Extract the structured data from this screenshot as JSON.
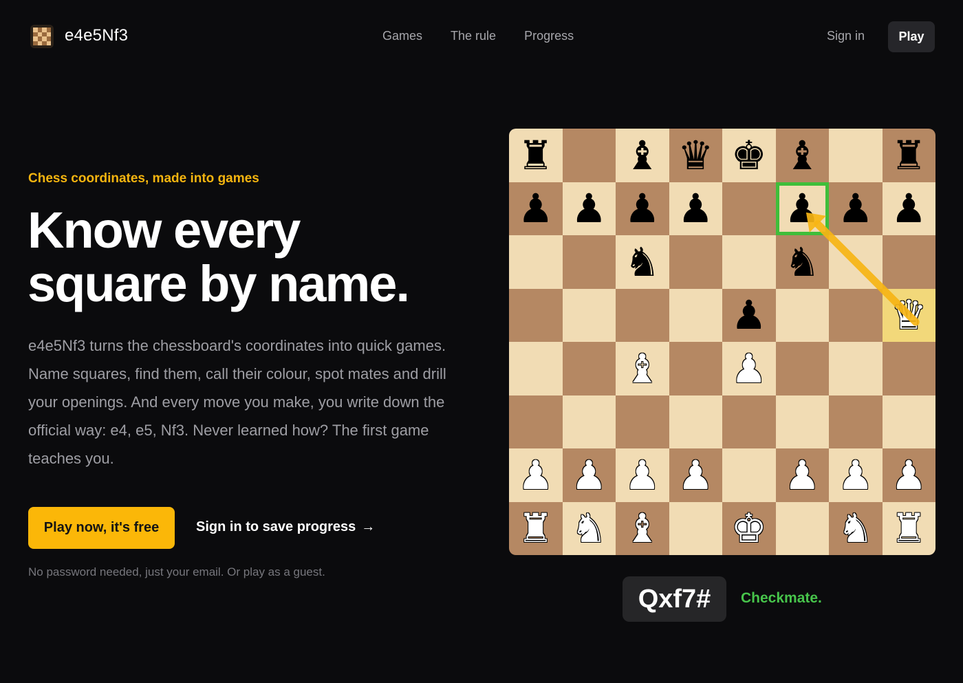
{
  "nav": {
    "brand": "e4e5Nf3",
    "logo_icon": "chessboard-logo-icon",
    "links": [
      {
        "label": "Games"
      },
      {
        "label": "The rule"
      },
      {
        "label": "Progress"
      }
    ],
    "signin_label": "Sign in",
    "play_label": "Play"
  },
  "hero": {
    "eyebrow": "Chess coordinates, made into games",
    "headline_line1": "Know every",
    "headline_line2": "square by name.",
    "lead": "e4e5Nf3 turns the chessboard's coordinates into quick games. Name squares, find them, call their colour, spot mates and drill your openings. And every move you make, you write down the official way: e4, e5, Nf3. Never learned how? The first game teaches you.",
    "cta_primary": "Play now, it's free",
    "cta_secondary": "Sign in to save progress",
    "cta_secondary_icon": "arrow-right-icon",
    "note": "No password needed, just your email. Or play as a guest."
  },
  "board": {
    "ranks": [
      "r.bqkb.r",
      "pppp.ppp",
      "..n..n..",
      "....p..Q",
      "..B.P...",
      "........",
      "PPPP.PPP",
      "RNB.K.NR"
    ],
    "highlight_target": "h5",
    "highlight_check": "f7",
    "arrow": {
      "from": "h5",
      "to": "f7"
    },
    "colors": {
      "light": "#f1dcb4",
      "dark": "#b58863",
      "target": "#f2d87a",
      "check": "#3fbe3a",
      "arrow": "#f7b515"
    }
  },
  "move": {
    "notation": "Qxf7#",
    "result": "Checkmate."
  },
  "colors": {
    "background": "#0b0b0d",
    "accent": "#fbb708",
    "success": "#47c44b"
  }
}
